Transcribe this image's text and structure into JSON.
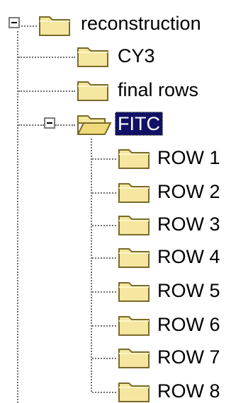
{
  "tree": {
    "root": {
      "label": "reconstruction",
      "icon": "folder-icon",
      "expanded": true,
      "children": [
        {
          "label": "CY3",
          "icon": "folder-icon"
        },
        {
          "label": "final rows",
          "icon": "folder-icon"
        },
        {
          "label": "FITC",
          "icon": "folder-open-icon",
          "expanded": true,
          "selected": true,
          "children": [
            {
              "label": "ROW 1",
              "icon": "folder-icon"
            },
            {
              "label": "ROW 2",
              "icon": "folder-icon"
            },
            {
              "label": "ROW 3",
              "icon": "folder-icon"
            },
            {
              "label": "ROW 4",
              "icon": "folder-icon"
            },
            {
              "label": "ROW 5",
              "icon": "folder-icon"
            },
            {
              "label": "ROW 6",
              "icon": "folder-icon"
            },
            {
              "label": "ROW 7",
              "icon": "folder-icon"
            },
            {
              "label": "ROW 8",
              "icon": "folder-icon"
            }
          ]
        }
      ]
    }
  },
  "colors": {
    "selection_background": "#111266",
    "selection_text": "#ffffff",
    "folder_fill": "#f5e6a0",
    "folder_outline": "#7a6a2a",
    "tree_lines": "#6f6f6f"
  }
}
